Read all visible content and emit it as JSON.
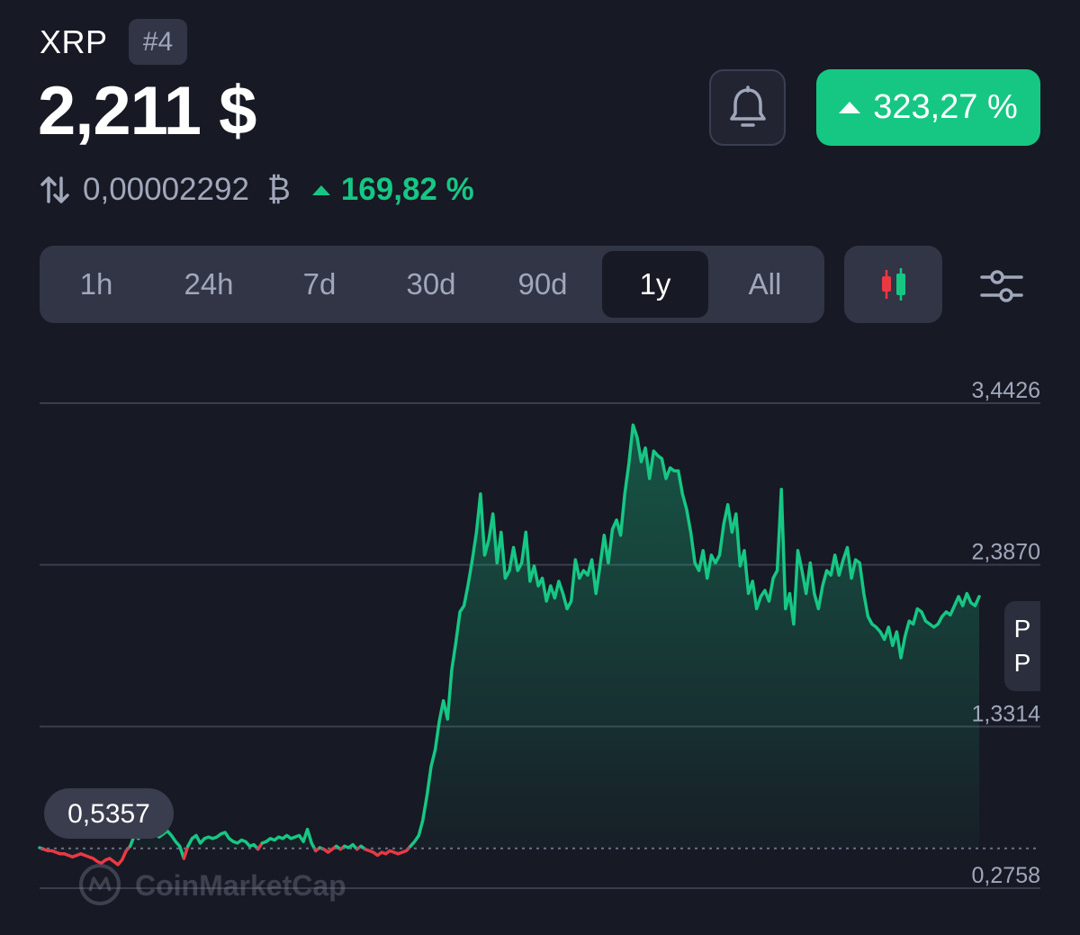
{
  "header": {
    "symbol": "XRP",
    "rank": "#4",
    "price": "2,211 $",
    "change_pct": "323,27 %",
    "btc_price": "0,00002292",
    "btc_symbol": "₿",
    "btc_change_pct": "169,82 %"
  },
  "ranges": {
    "items": [
      "1h",
      "24h",
      "7d",
      "30d",
      "90d",
      "1y",
      "All"
    ],
    "selected": "1y"
  },
  "icons": {
    "swap": "swap-arrows-icon",
    "bell": "bell-icon",
    "candle": "candlestick-icon",
    "settings": "sliders-icon",
    "triangle": "triangle-up-icon"
  },
  "colors": {
    "up": "#16c784",
    "down": "#ea3943",
    "background": "#171924",
    "panel": "#323546"
  },
  "watermark": "CoinMarketCap",
  "side_tab": [
    "P",
    "P"
  ],
  "chart_data": {
    "type": "line",
    "title": "",
    "xlabel": "",
    "ylabel": "",
    "ylim": [
      0.2758,
      3.4426
    ],
    "yticks": [
      "3,4426",
      "2,3870",
      "1,3314",
      "0,2758"
    ],
    "ytick_values": [
      3.4426,
      2.387,
      1.3314,
      0.2758
    ],
    "baseline": 0.5357,
    "baseline_label": "0,5357",
    "grid": true,
    "fill_under_line": true,
    "series": [
      {
        "values": [
          0.54,
          0.53,
          0.52,
          0.52,
          0.51,
          0.5,
          0.5,
          0.49,
          0.48,
          0.49,
          0.5,
          0.49,
          0.48,
          0.47,
          0.45,
          0.44,
          0.46,
          0.47,
          0.45,
          0.43,
          0.46,
          0.52,
          0.55,
          0.62,
          0.6,
          0.63,
          0.62,
          0.64,
          0.63,
          0.61,
          0.63,
          0.65,
          0.62,
          0.58,
          0.55,
          0.47,
          0.55,
          0.6,
          0.62,
          0.57,
          0.6,
          0.61,
          0.6,
          0.61,
          0.63,
          0.64,
          0.6,
          0.58,
          0.57,
          0.59,
          0.58,
          0.55,
          0.56,
          0.53,
          0.57,
          0.58,
          0.6,
          0.59,
          0.61,
          0.6,
          0.62,
          0.6,
          0.61,
          0.62,
          0.58,
          0.66,
          0.57,
          0.52,
          0.54,
          0.53,
          0.51,
          0.53,
          0.55,
          0.53,
          0.55,
          0.54,
          0.56,
          0.53,
          0.55,
          0.53,
          0.52,
          0.51,
          0.49,
          0.51,
          0.5,
          0.52,
          0.51,
          0.5,
          0.51,
          0.52,
          0.55,
          0.58,
          0.62,
          0.72,
          0.88,
          1.07,
          1.18,
          1.37,
          1.5,
          1.38,
          1.7,
          1.88,
          2.08,
          2.12,
          2.26,
          2.42,
          2.6,
          2.85,
          2.45,
          2.55,
          2.72,
          2.4,
          2.6,
          2.3,
          2.35,
          2.5,
          2.35,
          2.4,
          2.6,
          2.28,
          2.38,
          2.25,
          2.3,
          2.15,
          2.25,
          2.17,
          2.28,
          2.2,
          2.1,
          2.15,
          2.42,
          2.3,
          2.35,
          2.32,
          2.42,
          2.2,
          2.38,
          2.58,
          2.4,
          2.62,
          2.68,
          2.58,
          2.85,
          3.05,
          3.3,
          3.22,
          3.06,
          3.15,
          2.95,
          3.13,
          3.1,
          3.08,
          2.95,
          3.02,
          3.0,
          3.0,
          2.85,
          2.75,
          2.6,
          2.4,
          2.35,
          2.48,
          2.3,
          2.45,
          2.4,
          2.45,
          2.65,
          2.78,
          2.6,
          2.72,
          2.38,
          2.48,
          2.2,
          2.28,
          2.1,
          2.18,
          2.22,
          2.15,
          2.3,
          2.35,
          2.88,
          2.1,
          2.2,
          2.0,
          2.48,
          2.35,
          2.2,
          2.4,
          2.2,
          2.1,
          2.25,
          2.35,
          2.32,
          2.45,
          2.32,
          2.42,
          2.5,
          2.3,
          2.42,
          2.4,
          2.2,
          2.05,
          2.0,
          1.98,
          1.95,
          1.9,
          1.98,
          1.86,
          1.95,
          1.78,
          1.92,
          2.02,
          2.0,
          2.1,
          2.08,
          2.02,
          2.0,
          1.98,
          2.0,
          2.05,
          2.08,
          2.06,
          2.12,
          2.18,
          2.12,
          2.2,
          2.14,
          2.12,
          2.18
        ]
      }
    ]
  }
}
